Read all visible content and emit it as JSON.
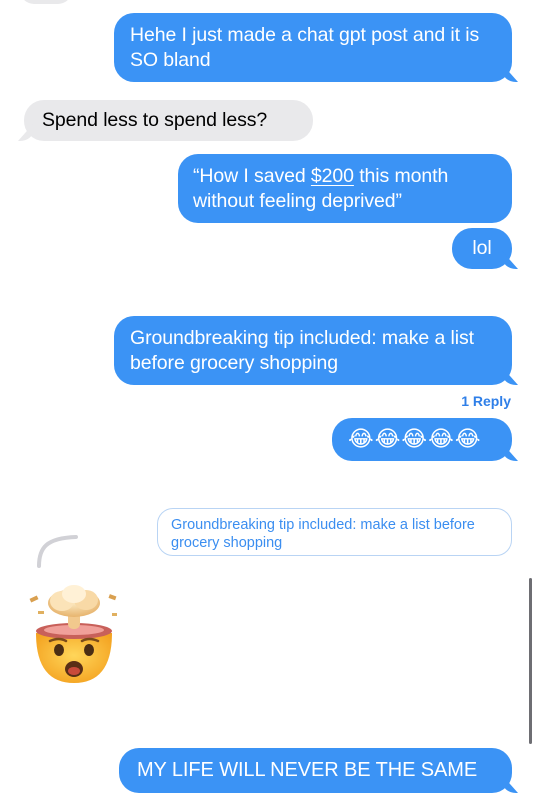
{
  "messages": [
    {
      "text": "Hehe I just made a chat gpt post and it is SO bland"
    },
    {
      "text": "Spend less to spend less?"
    },
    {
      "text_before": "“How I saved ",
      "link_text": "$200",
      "text_after": " this month without feeling deprived”"
    },
    {
      "text": "lol"
    },
    {
      "text": "Groundbreaking tip included: make a list before grocery shopping"
    },
    {
      "reply_count": "1 Reply"
    },
    {
      "emoji": "😂😂😂😂😂"
    },
    {
      "quoted_text": "Groundbreaking tip included: make a list before grocery shopping"
    },
    {
      "emoji": "exploding-head-emoji"
    },
    {
      "text": "MY LIFE WILL NEVER BE THE SAME"
    }
  ],
  "colors": {
    "outgoing_bubble": "#3b93f5",
    "incoming_bubble": "#e9e9eb",
    "link": "#2f7fe8"
  }
}
